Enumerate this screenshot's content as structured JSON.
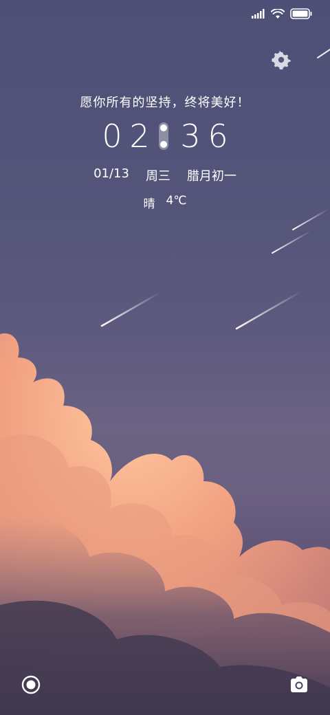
{
  "status_bar": {
    "icons": [
      "signal-icon",
      "wifi-icon",
      "battery-icon"
    ]
  },
  "settings": {
    "icon": "gear-icon"
  },
  "lockscreen": {
    "motto": "愿你所有的坚持，终将美好！",
    "clock": {
      "hour_tens": "0",
      "hour_ones": "2",
      "minute_tens": "3",
      "minute_ones": "6"
    },
    "date": "01/13",
    "weekday": "周三",
    "lunar_date": "腊月初一",
    "weather": "晴",
    "temperature": "4℃"
  },
  "shortcuts": {
    "left_icon": "voice-assistant-icon",
    "right_icon": "camera-icon"
  },
  "colors": {
    "sky_top": "#4d4f76",
    "sky_mid": "#6b6383",
    "cloud_light": "#f4b08c",
    "cloud_mid": "#e8957a",
    "cloud_dark": "#5a4d6a",
    "text": "#ffffff"
  }
}
